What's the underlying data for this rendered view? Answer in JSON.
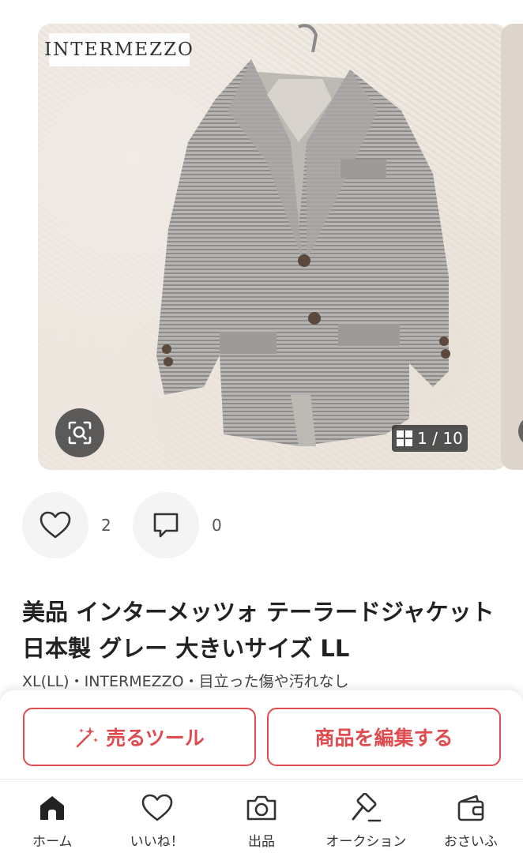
{
  "gallery": {
    "brand_tag": "INTERMEZZO",
    "counter": "1 / 10",
    "current": 1,
    "total": 10
  },
  "reactions": {
    "likes_count": "2",
    "comments_count": "0"
  },
  "product": {
    "title": "美品 インターメッツォ テーラードジャケット 日本製 グレー 大きいサイズ LL",
    "meta": "XL(LL)・INTERMEZZO・目立った傷や汚れなし"
  },
  "actions": {
    "sell_tool_label": "売るツール",
    "edit_label": "商品を編集する"
  },
  "tabbar": {
    "items": [
      {
        "label": "ホーム",
        "icon": "home-icon",
        "active": true
      },
      {
        "label": "いいね！",
        "icon": "heart-icon",
        "active": false
      },
      {
        "label": "出品",
        "icon": "camera-icon",
        "active": false
      },
      {
        "label": "オークション",
        "icon": "gavel-icon",
        "active": false
      },
      {
        "label": "おさいふ",
        "icon": "wallet-icon",
        "active": false
      }
    ]
  },
  "colors": {
    "accent": "#e04b4f",
    "text": "#222222"
  }
}
